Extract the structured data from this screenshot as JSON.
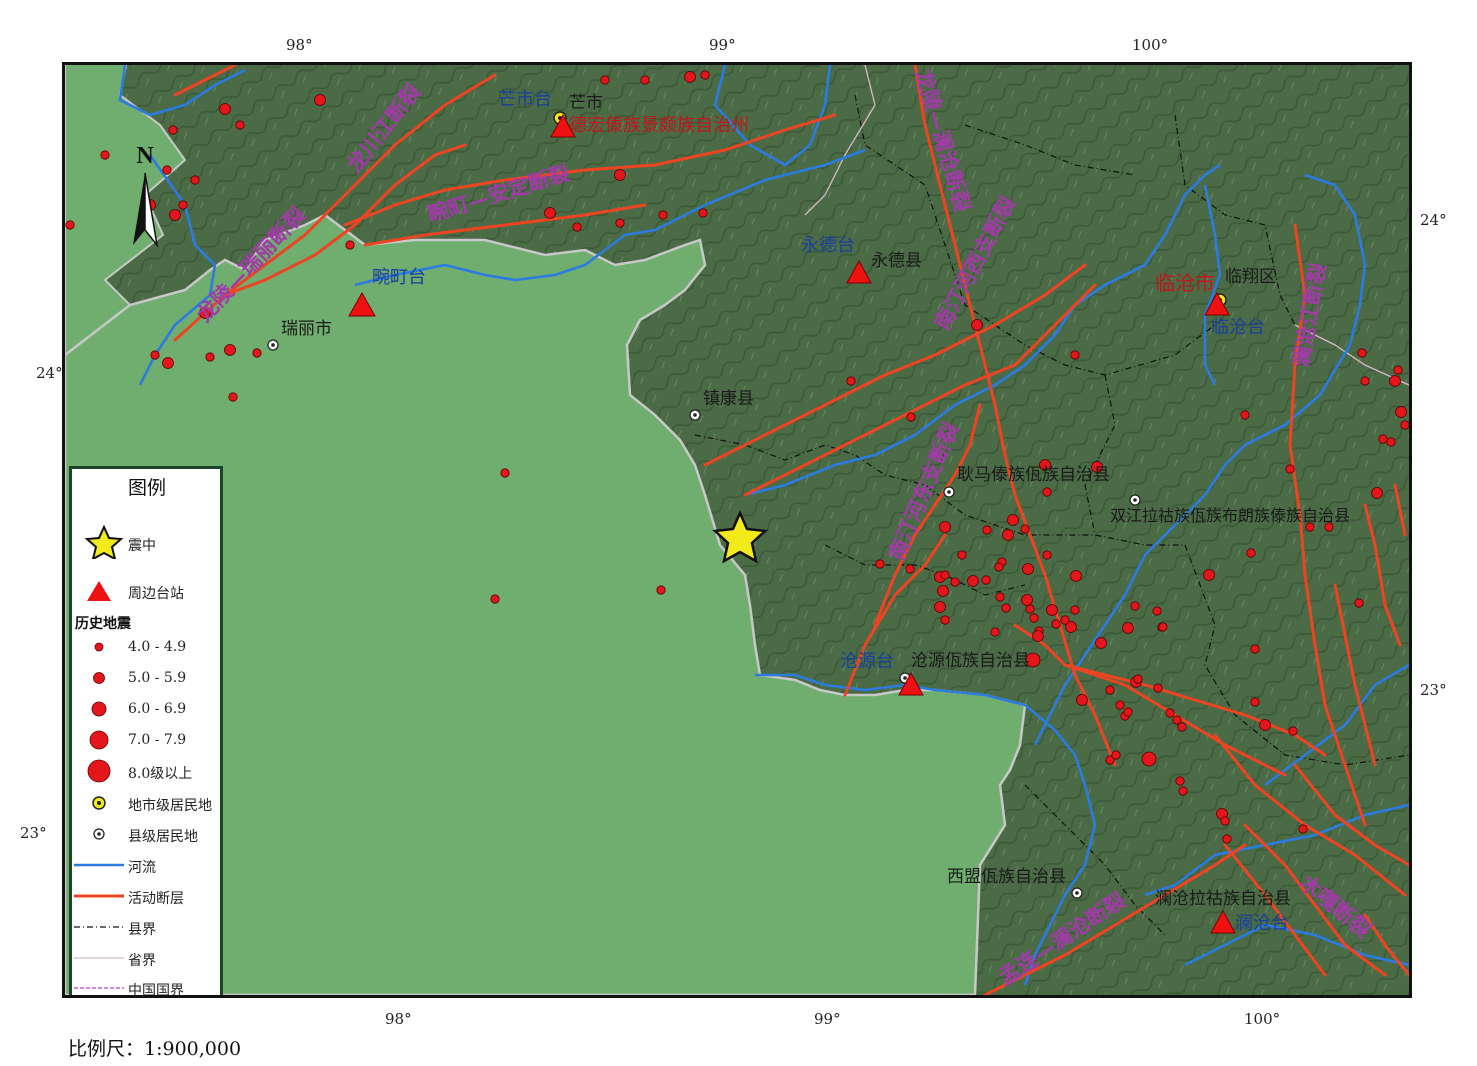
{
  "axes": {
    "top_ticks": [
      "98°",
      "99°",
      "100°"
    ],
    "bottom_ticks": [
      "98°",
      "99°",
      "100°"
    ],
    "left_ticks": [
      "24°",
      "23°"
    ],
    "right_ticks": [
      "24°",
      "23°"
    ]
  },
  "stations": [
    "芒市台",
    "永德台",
    "畹町台",
    "临沧台",
    "沧源台",
    "澜沧台"
  ],
  "places": [
    "芒市",
    "德宏傣族景颇族自治州",
    "永德县",
    "临沧市",
    "临翔区",
    "瑞丽市",
    "镇康县",
    "耿马傣族佤族自治县",
    "双江拉祜族佤族布朗族傣族自治县",
    "沧源佤族自治县",
    "西盟佤族自治县",
    "澜沧拉祜族自治县"
  ],
  "faults": [
    "龙川江断裂",
    "畹町—安定断裂",
    "龙陵—瑞丽断裂",
    "龙陵—澜沧断裂",
    "南汀河西支断裂",
    "南汀河东支断裂",
    "澜沧江断裂",
    "孟连—澜沧断裂",
    "木嘎断裂"
  ],
  "compass": "N",
  "legend": {
    "title": "图例",
    "epicenter": "震中",
    "station": "周边台站",
    "history_title": "历史地震",
    "magnitudes": [
      "4.0 - 4.9",
      "5.0 - 5.9",
      "6.0 - 6.9",
      "7.0 - 7.9",
      "8.0级以上"
    ],
    "city_level": "地市级居民地",
    "county_level": "县级居民地",
    "river": "河流",
    "fault": "活动断层",
    "county_border": "县界",
    "province_border": "省界",
    "national_border": "中国国界"
  },
  "scale": "比例尺：1:900,000",
  "colors": {
    "terrain": "#4a6b45",
    "lowland": "#6fae6f",
    "river": "#2c7be0",
    "fault": "#ee4422",
    "quake": "#e3161c",
    "station": "#ee1111",
    "epicenter": "#f2ea1a",
    "fault_label": "#a23aa8",
    "station_label": "#1a3f9c"
  },
  "epicenter": {
    "lon": 98.8,
    "lat": 23.55
  },
  "quake_magnitudes": [
    4.5,
    4.5,
    5.0,
    4.5,
    4.5,
    5.5,
    4.5,
    5.0,
    4.5,
    4.5,
    5.0,
    4.5,
    4.5,
    5.5,
    4.5,
    5.0,
    4.5,
    4.5,
    4.5,
    5.0,
    4.5,
    5.0,
    4.5,
    5.0,
    4.5,
    4.5,
    4.5,
    5.0,
    4.5,
    4.5,
    4.5,
    4.5,
    4.5,
    4.5,
    5.5,
    4.5,
    5.0,
    4.5,
    5.0,
    4.5,
    4.5,
    4.5,
    4.5,
    5.0,
    4.5,
    5.0,
    4.5,
    4.5,
    4.5,
    5.0,
    4.5,
    4.5,
    4.5,
    5.0,
    4.5,
    4.5,
    4.5,
    5.0,
    4.5,
    4.5,
    5.0,
    4.5,
    5.0,
    4.5,
    5.0,
    5.0,
    4.5,
    5.0,
    4.5,
    4.5,
    4.5,
    5.0,
    4.5,
    5.0,
    4.5,
    4.5,
    5.0,
    4.5,
    4.5,
    5.0,
    4.5,
    5.0,
    4.5,
    4.5,
    4.5,
    5.0,
    4.5,
    5.5,
    6.5,
    4.5,
    4.5,
    5.0,
    4.5,
    5.0,
    4.5,
    4.5,
    4.5,
    5.0,
    4.5,
    4.5,
    4.5,
    4.5,
    6.0,
    5.0,
    4.5,
    4.5,
    4.5,
    4.5,
    4.5,
    4.5,
    4.5,
    5.0,
    4.5,
    4.5,
    4.5,
    4.5,
    5.0,
    4.5,
    4.5,
    4.5
  ]
}
